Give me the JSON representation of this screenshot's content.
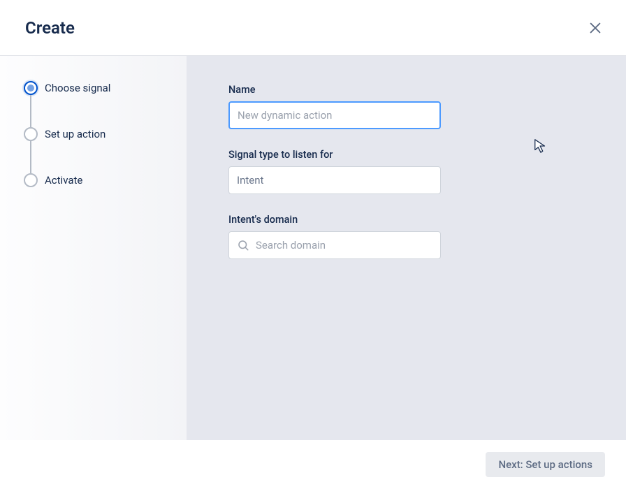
{
  "header": {
    "title": "Create"
  },
  "stepper": {
    "steps": [
      {
        "label": "Choose signal",
        "active": true
      },
      {
        "label": "Set up action",
        "active": false
      },
      {
        "label": "Activate",
        "active": false
      }
    ]
  },
  "form": {
    "name": {
      "label": "Name",
      "placeholder": "New dynamic action",
      "value": ""
    },
    "signal_type": {
      "label": "Signal type to listen for",
      "value": "Intent"
    },
    "intent_domain": {
      "label": "Intent's domain",
      "placeholder": "Search domain",
      "value": ""
    }
  },
  "footer": {
    "next_label": "Next: Set up actions"
  }
}
